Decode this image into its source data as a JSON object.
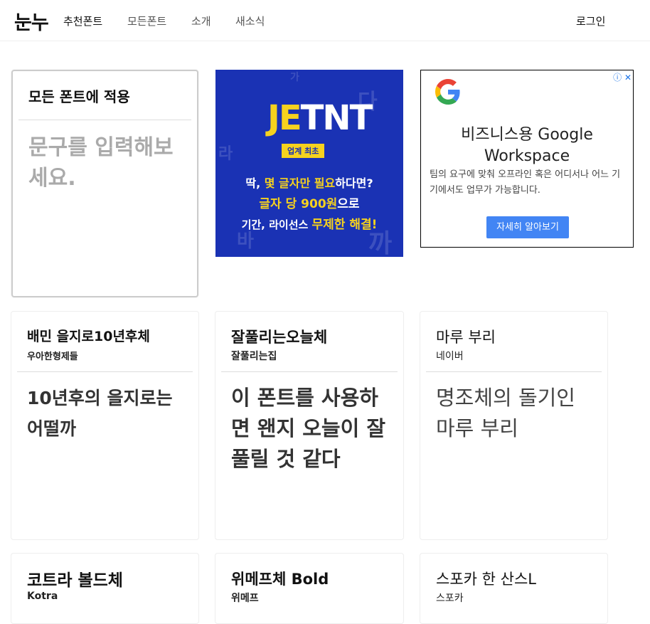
{
  "nav": {
    "logo": "눈누",
    "links": [
      "추천폰트",
      "모든폰트",
      "소개",
      "새소식"
    ],
    "login": "로그인"
  },
  "apply": {
    "title": "모든 폰트에 적용",
    "placeholder": "문구를 입력해보세요."
  },
  "ad_jetnt": {
    "logo_a": "JE",
    "logo_b": "T",
    "logo_c": "NT",
    "badge": "업계 최초",
    "line1_a": "딱, ",
    "line1_b": "몇 글자만 필요",
    "line1_c": "하다면?",
    "line2_a": "글자 당 900원",
    "line2_b": "으로",
    "line3_a": "기간, 라이선스 ",
    "line3_b": "무제한 해결!"
  },
  "ad_google": {
    "title": "비즈니스용 Google Workspace",
    "desc": "팀의 요구에 맞춰 오프라인 혹은 어디서나 어느 기기에서도 업무가 가능합니다.",
    "button": "자세히 알아보기",
    "icons": "ⓘ ✕",
    "colors": {
      "blue": "#4285f4",
      "red": "#ea4335",
      "yellow": "#fbbc05",
      "green": "#34a853"
    }
  },
  "fonts": [
    {
      "name": "배민 을지로10년후체",
      "maker": "우아한형제들",
      "sample": "10년후의 을지로는 어떨까"
    },
    {
      "name": "잘풀리는오늘체",
      "maker": "잘풀리는집",
      "sample": "이 폰트를 사용하면 왠지 오늘이 잘 풀릴 것 같다"
    },
    {
      "name": "마루 부리",
      "maker": "네이버",
      "sample": "명조체의 돌기인 마루 부리"
    },
    {
      "name": "코트라 볼드체",
      "maker": "Kotra",
      "sample": ""
    },
    {
      "name": "위메프체 Bold",
      "maker": "위메프",
      "sample": ""
    },
    {
      "name": "스포카 한 산스L",
      "maker": "스포카",
      "sample": ""
    }
  ]
}
